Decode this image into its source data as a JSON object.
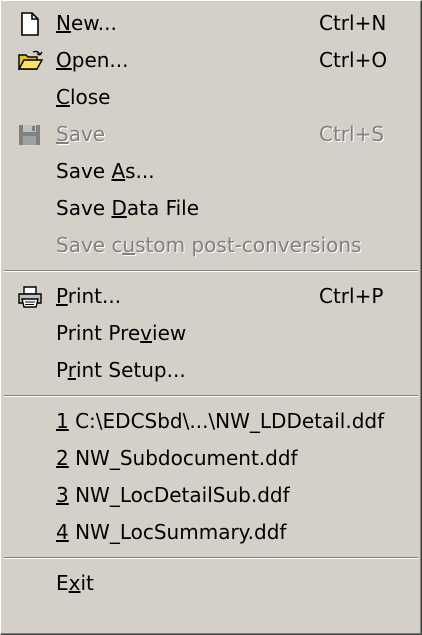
{
  "menu": {
    "items": [
      {
        "id": "new",
        "label_pre": "",
        "mnemonic": "N",
        "label_post": "ew...",
        "shortcut": "Ctrl+N",
        "icon": "new-document-icon",
        "enabled": true
      },
      {
        "id": "open",
        "label_pre": "",
        "mnemonic": "O",
        "label_post": "pen...",
        "shortcut": "Ctrl+O",
        "icon": "open-folder-icon",
        "enabled": true
      },
      {
        "id": "close",
        "label_pre": "",
        "mnemonic": "C",
        "label_post": "lose",
        "shortcut": "",
        "icon": "",
        "enabled": true
      },
      {
        "id": "save",
        "label_pre": "",
        "mnemonic": "S",
        "label_post": "ave",
        "shortcut": "Ctrl+S",
        "icon": "floppy-disk-icon",
        "enabled": false
      },
      {
        "id": "save-as",
        "label_pre": "Save ",
        "mnemonic": "A",
        "label_post": "s...",
        "shortcut": "",
        "icon": "",
        "enabled": true
      },
      {
        "id": "save-data-file",
        "label_pre": "Save ",
        "mnemonic": "D",
        "label_post": "ata File",
        "shortcut": "",
        "icon": "",
        "enabled": true
      },
      {
        "id": "save-custom-post-conversions",
        "label_pre": "Save c",
        "mnemonic": "u",
        "label_post": "stom post-conversions",
        "shortcut": "",
        "icon": "",
        "enabled": false
      },
      {
        "separator": true
      },
      {
        "id": "print",
        "label_pre": "",
        "mnemonic": "P",
        "label_post": "rint...",
        "shortcut": "Ctrl+P",
        "icon": "printer-icon",
        "enabled": true
      },
      {
        "id": "print-preview",
        "label_pre": "Print Pre",
        "mnemonic": "v",
        "label_post": "iew",
        "shortcut": "",
        "icon": "",
        "enabled": true
      },
      {
        "id": "print-setup",
        "label_pre": "P",
        "mnemonic": "r",
        "label_post": "int Setup...",
        "shortcut": "",
        "icon": "",
        "enabled": true
      },
      {
        "separator": true
      },
      {
        "id": "recent-1",
        "label_pre": "",
        "mnemonic": "1",
        "label_post": " C:\\EDCSbd\\...\\NW_LDDetail.ddf",
        "shortcut": "",
        "icon": "",
        "enabled": true
      },
      {
        "id": "recent-2",
        "label_pre": "",
        "mnemonic": "2",
        "label_post": " NW_Subdocument.ddf",
        "shortcut": "",
        "icon": "",
        "enabled": true
      },
      {
        "id": "recent-3",
        "label_pre": "",
        "mnemonic": "3",
        "label_post": " NW_LocDetailSub.ddf",
        "shortcut": "",
        "icon": "",
        "enabled": true
      },
      {
        "id": "recent-4",
        "label_pre": "",
        "mnemonic": "4",
        "label_post": " NW_LocSummary.ddf",
        "shortcut": "",
        "icon": "",
        "enabled": true
      },
      {
        "separator": true
      },
      {
        "id": "exit",
        "label_pre": "E",
        "mnemonic": "x",
        "label_post": "it",
        "shortcut": "",
        "icon": "",
        "enabled": true
      }
    ]
  },
  "colors": {
    "menu_background": "#d4d0c8",
    "text": "#000000",
    "disabled_text": "#808080"
  }
}
